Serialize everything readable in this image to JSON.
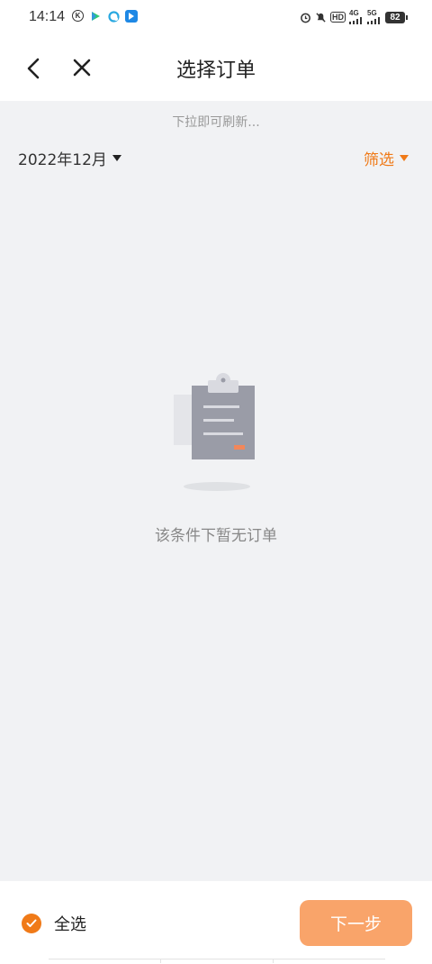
{
  "status_bar": {
    "time": "14:14",
    "left_icons": [
      "k-icon",
      "play-icon",
      "bird-icon",
      "map-icon"
    ],
    "right_icons": [
      "alarm-icon",
      "mute-icon",
      "hd-icon",
      "signal-4g-icon",
      "signal-5g-icon"
    ],
    "network_1": "4G",
    "network_2": "5G",
    "hd_label": "HD",
    "battery": "82"
  },
  "navbar": {
    "title": "选择订单"
  },
  "list": {
    "refresh_hint": "下拉即可刷新...",
    "month": "2022年12月",
    "filter_label": "筛选"
  },
  "empty_state": {
    "message": "该条件下暂无订单"
  },
  "footer": {
    "select_all_label": "全选",
    "next_label": "下一步"
  },
  "colors": {
    "accent": "#f07a18",
    "button": "#f9a46a",
    "background": "#f1f2f4"
  }
}
